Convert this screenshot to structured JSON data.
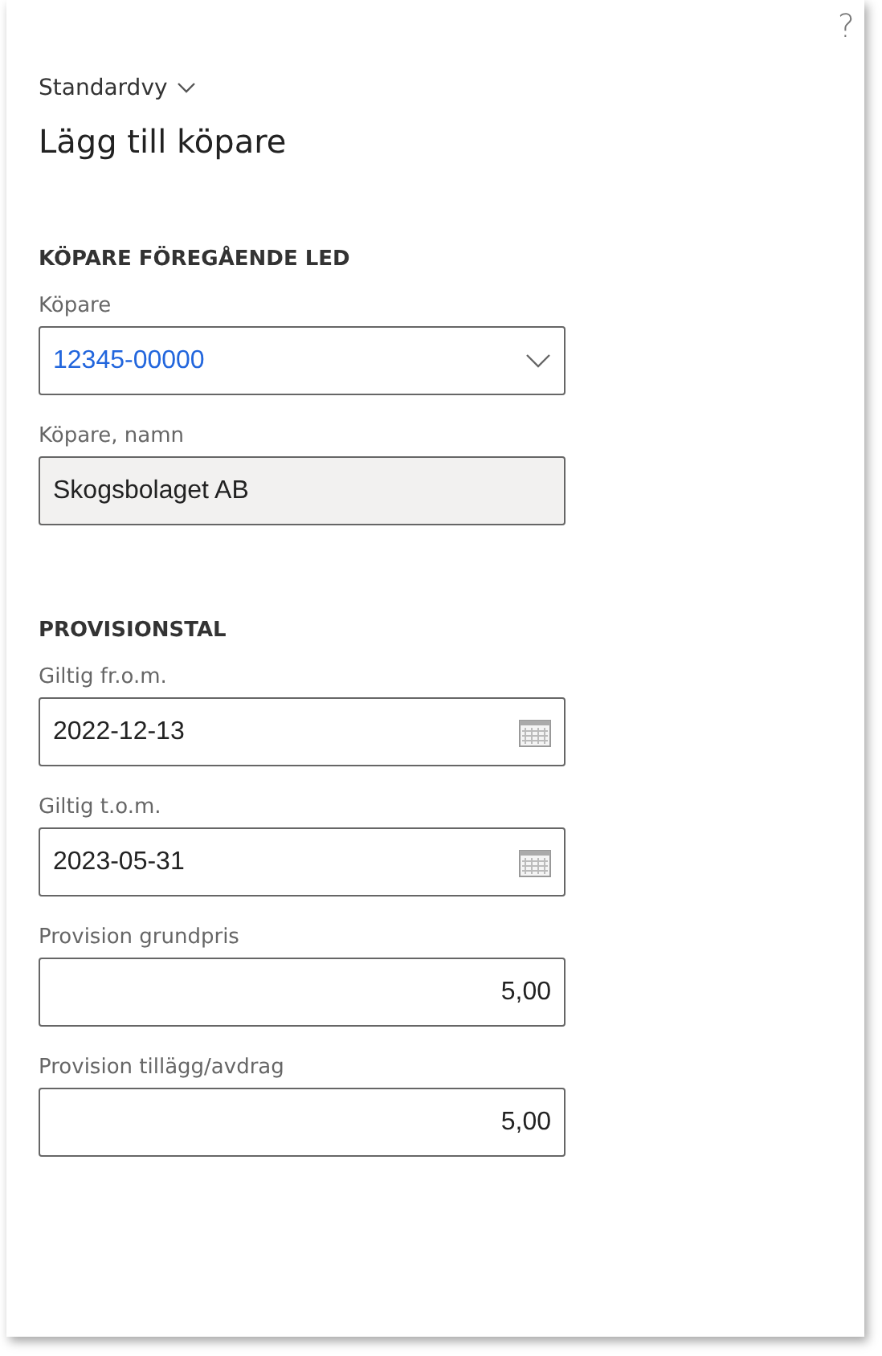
{
  "help": "?",
  "view_selector": {
    "label": "Standardvy"
  },
  "title": "Lägg till köpare",
  "sections": [
    {
      "heading": "KÖPARE FÖREGÅENDE LED",
      "fields": [
        {
          "label": "Köpare",
          "kind": "lookup",
          "value": "12345-00000"
        },
        {
          "label": "Köpare, namn",
          "kind": "readonly",
          "value": "Skogsbolaget AB"
        }
      ]
    },
    {
      "heading": "PROVISIONSTAL",
      "fields": [
        {
          "label": "Giltig fr.o.m.",
          "kind": "date",
          "value": "2022-12-13"
        },
        {
          "label": "Giltig t.o.m.",
          "kind": "date",
          "value": "2023-05-31"
        },
        {
          "label": "Provision grundpris",
          "kind": "number",
          "value": "5,00"
        },
        {
          "label": "Provision tillägg/avdrag",
          "kind": "number",
          "value": "5,00"
        }
      ]
    }
  ]
}
